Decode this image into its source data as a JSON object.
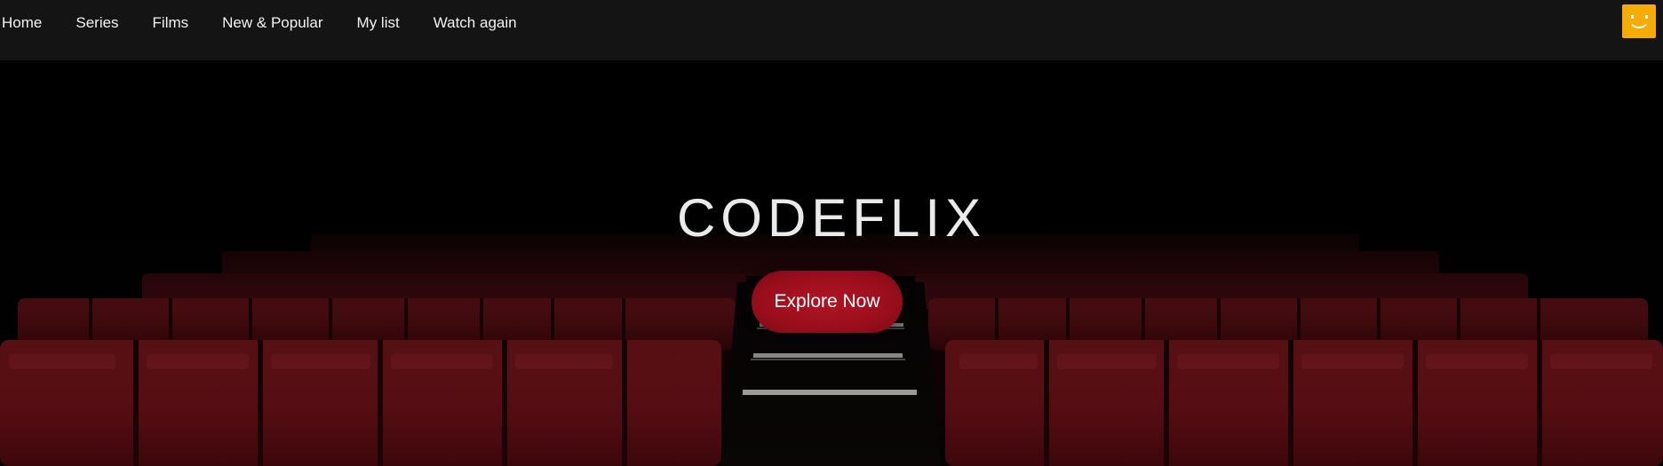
{
  "nav": {
    "items": [
      {
        "label": "Home"
      },
      {
        "label": "Series"
      },
      {
        "label": "Films"
      },
      {
        "label": "New & Popular"
      },
      {
        "label": "My list"
      },
      {
        "label": "Watch again"
      }
    ],
    "avatar_icon": "smiley-face-icon",
    "avatar_color": "#f5ac06"
  },
  "hero": {
    "title": "CODEFLIX",
    "cta_label": "Explore Now",
    "cta_color": "#a5101e",
    "background_icon": "cinema-seats-image"
  }
}
